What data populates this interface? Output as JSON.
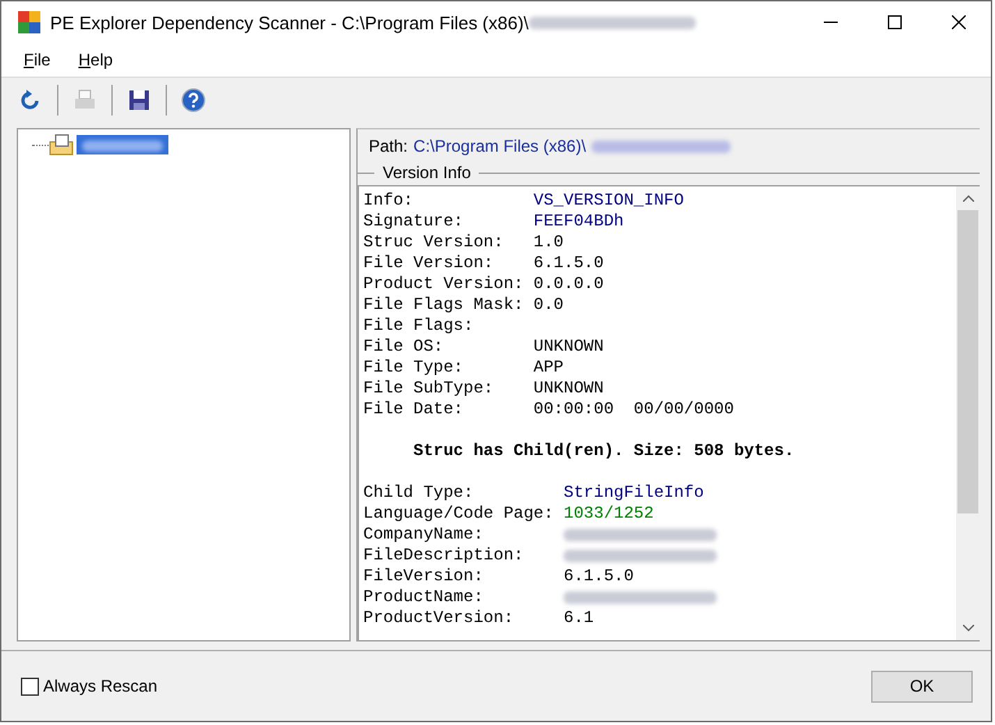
{
  "window": {
    "title": "PE Explorer Dependency Scanner - C:\\Program Files (x86)\\",
    "title_redacted": true
  },
  "menu": [
    {
      "label": "File"
    },
    {
      "label": "Help"
    }
  ],
  "toolbar": [
    {
      "kind": "refresh",
      "disabled": false
    },
    {
      "kind": "print",
      "disabled": true
    },
    {
      "kind": "save",
      "disabled": false
    },
    {
      "kind": "help",
      "disabled": false
    }
  ],
  "tree": {
    "items": [
      {
        "redacted": true,
        "selected": true
      }
    ]
  },
  "path": {
    "label": "Path:",
    "value": "C:\\Program Files (x86)\\",
    "redacted": true
  },
  "version_info": {
    "title": "Version Info",
    "sections": [
      {
        "kind": "fields",
        "rows": [
          {
            "label": "Info:",
            "value": "VS_VERSION_INFO",
            "color": "#000080"
          },
          {
            "label": "Signature:",
            "value": "FEEF04BDh",
            "color": "#000080"
          },
          {
            "label": "Struc Version:",
            "value": "1.0",
            "color": "#000000"
          },
          {
            "label": "File Version:",
            "value": "6.1.5.0",
            "color": "#000000"
          },
          {
            "label": "Product Version:",
            "value": "0.0.0.0",
            "color": "#000000"
          },
          {
            "label": "File Flags Mask:",
            "value": "0.0",
            "color": "#000000"
          },
          {
            "label": "File Flags:"
          },
          {
            "label": "File OS:",
            "value": "UNKNOWN",
            "color": "#000000"
          },
          {
            "label": "File Type:",
            "value": "APP",
            "color": "#000000"
          },
          {
            "label": "File SubType:",
            "value": "UNKNOWN",
            "color": "#000000"
          },
          {
            "label": "File Date:",
            "value": "00:00:00  00/00/0000",
            "color": "#000000"
          }
        ]
      },
      {
        "kind": "note",
        "text": "Struc has Child(ren). Size: 508 bytes."
      },
      {
        "kind": "fields",
        "rows": [
          {
            "label": "Child Type:",
            "value": "StringFileInfo",
            "color": "#000080"
          },
          {
            "label": "Language/Code Page:",
            "value": "1033/1252",
            "color": "#008000"
          },
          {
            "label": "CompanyName:",
            "redacted": true
          },
          {
            "label": "FileDescription:",
            "redacted": true
          },
          {
            "label": "FileVersion:",
            "value": "6.1.5.0",
            "color": "#000000"
          },
          {
            "label": "ProductName:",
            "redacted": true
          },
          {
            "label": "ProductVersion:",
            "value": "6.1",
            "color": "#000000"
          }
        ]
      }
    ]
  },
  "always_rescan": {
    "label": "Always Rescan",
    "checked": false
  },
  "ok_button": {
    "label": "OK"
  }
}
